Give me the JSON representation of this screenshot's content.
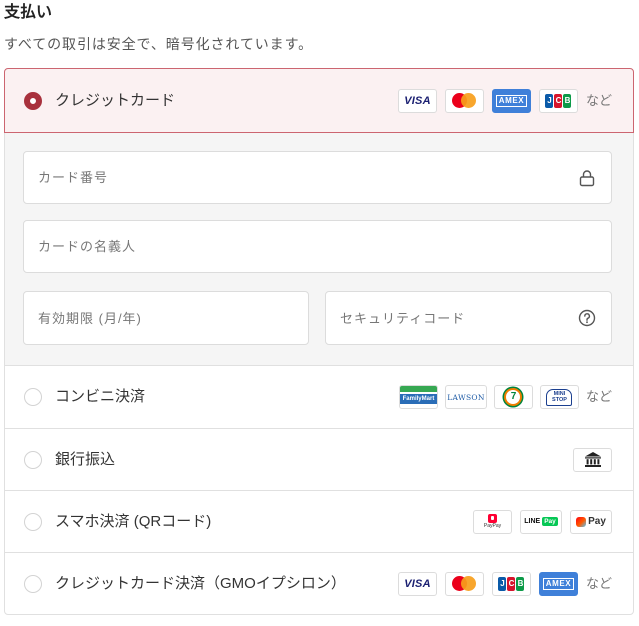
{
  "page": {
    "title": "支払い",
    "subtitle": "すべての取引は安全で、暗号化されています。"
  },
  "payment_methods": {
    "credit_card": {
      "label": "クレジットカード",
      "selected": true,
      "logos": {
        "visa": "VISA",
        "amex": "AMEX",
        "jcb": [
          "J",
          "C",
          "B"
        ]
      },
      "more": "など",
      "form": {
        "card_number": {
          "placeholder": "カード番号",
          "value": "",
          "icon": "lock-icon"
        },
        "cardholder_name": {
          "placeholder": "カードの名義人",
          "value": ""
        },
        "expiry": {
          "placeholder": "有効期限 (月/年)",
          "value": ""
        },
        "security_code": {
          "placeholder": "セキュリティコード",
          "value": "",
          "icon": "help-circle-icon"
        }
      }
    },
    "convenience_store": {
      "label": "コンビニ決済",
      "selected": false,
      "logos": {
        "familymart": "FamilyMart",
        "lawson": "LAWSON",
        "seven_eleven": "7",
        "ministop": [
          "MINI",
          "STOP"
        ]
      },
      "more": "など"
    },
    "bank_transfer": {
      "label": "銀行振込",
      "selected": false,
      "icon": "bank-icon"
    },
    "smartphone_qr": {
      "label": "スマホ決済 (QRコード)",
      "selected": false,
      "logos": {
        "paypay": "PayPay",
        "line_pay": [
          "LINE",
          "Pay"
        ],
        "merpay": "Pay"
      }
    },
    "gmo_epsilon": {
      "label": "クレジットカード決済（GMOイプシロン）",
      "selected": false,
      "logos": {
        "visa": "VISA",
        "jcb": [
          "J",
          "C",
          "B"
        ],
        "amex": "AMEX"
      },
      "more": "など"
    }
  },
  "colors": {
    "accent": "#a8313d",
    "selected_border": "#cc6570",
    "selected_bg": "#fbf1f2",
    "panel_bg": "#f5f5f5",
    "border": "#e0e0e0"
  }
}
